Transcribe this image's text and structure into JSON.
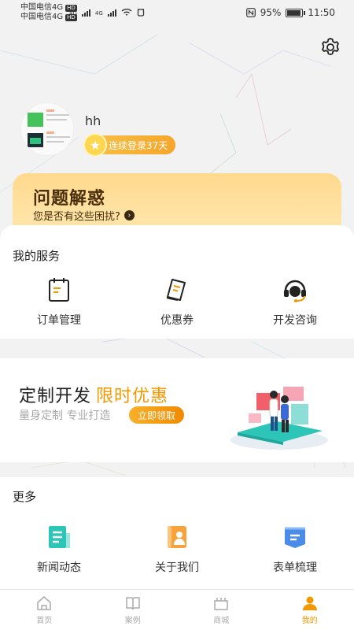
{
  "status_bar": {
    "carrier1": "中国电信4G",
    "carrier2": "中国电信4G",
    "hd": "HD",
    "net1": "4G",
    "net2": "4G",
    "battery_pct": "95%",
    "battery_level": 0.95,
    "time": "11:50"
  },
  "profile": {
    "username": "hh",
    "login_streak": "连续登录37天"
  },
  "problem_banner": {
    "title": "问题解惑",
    "subtitle": "您是否有这些困扰?"
  },
  "services": {
    "title": "我的服务",
    "items": [
      {
        "label": "订单管理",
        "icon": "clipboard-icon"
      },
      {
        "label": "优惠券",
        "icon": "coupon-icon"
      },
      {
        "label": "开发咨询",
        "icon": "headset-icon"
      }
    ]
  },
  "promo": {
    "title": "定制开发",
    "highlight": "限时优惠",
    "subtitle": "量身定制 专业打造",
    "button": "立即领取"
  },
  "more": {
    "title": "更多",
    "items": [
      {
        "label": "新闻动态",
        "icon": "news-icon"
      },
      {
        "label": "关于我们",
        "icon": "about-us-icon"
      },
      {
        "label": "表单梳理",
        "icon": "form-icon"
      }
    ]
  },
  "tabbar": {
    "items": [
      {
        "label": "首页",
        "icon": "home-icon"
      },
      {
        "label": "案例",
        "icon": "book-icon"
      },
      {
        "label": "商城",
        "icon": "shop-icon"
      },
      {
        "label": "我的",
        "icon": "user-icon"
      }
    ],
    "active_index": 3
  },
  "colors": {
    "accent": "#f39800",
    "banner": "#ffd98d",
    "teal": "#2cc5b8"
  }
}
